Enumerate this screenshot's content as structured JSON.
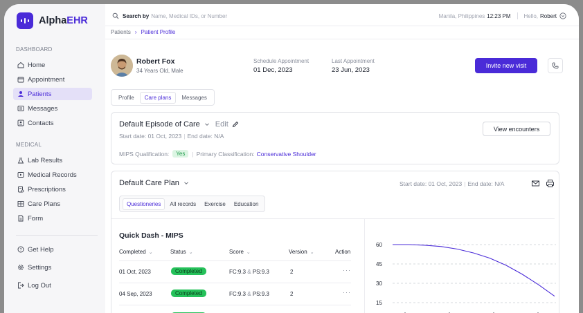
{
  "brand": {
    "name_prefix": "Alpha",
    "name_suffix": "EHR",
    "accent": "#4a2bd8"
  },
  "sidebar": {
    "dashboard_label": "DASHBOARD",
    "medical_label": "MEDICAL",
    "items": [
      {
        "label": "Home",
        "icon": "home-icon"
      },
      {
        "label": "Appointment",
        "icon": "calendar-icon"
      },
      {
        "label": "Patients",
        "icon": "user-icon",
        "active": true
      },
      {
        "label": "Messages",
        "icon": "message-icon"
      },
      {
        "label": "Contacts",
        "icon": "contacts-icon"
      }
    ],
    "medical_items": [
      {
        "label": "Lab Results",
        "icon": "flask-icon"
      },
      {
        "label": "Medical Records",
        "icon": "video-icon"
      },
      {
        "label": "Prescriptions",
        "icon": "prescription-icon"
      },
      {
        "label": "Care Plans",
        "icon": "grid-icon"
      },
      {
        "label": "Form",
        "icon": "document-icon"
      }
    ],
    "footer_items": [
      {
        "label": "Get Help",
        "icon": "help-icon"
      },
      {
        "label": "Settings",
        "icon": "gear-icon"
      },
      {
        "label": "Log Out",
        "icon": "logout-icon"
      }
    ]
  },
  "topbar": {
    "search_label": "Search by",
    "search_placeholder": "Name, Medical IDs, or Number",
    "location": "Manila, Philippines",
    "time": "12:23 PM",
    "greeting": "Hello,",
    "user": "Robert"
  },
  "breadcrumb": {
    "parent": "Patients",
    "current": "Patient Profile"
  },
  "patient": {
    "name": "Robert Fox",
    "meta": "34 Years Old, Male",
    "schedule_label": "Schedule Appointment",
    "schedule_value": "01 Dec, 2023",
    "last_label": "Last Appointment",
    "last_value": "23 Jun, 2023",
    "invite_label": "Invite new visit"
  },
  "tabs": [
    {
      "label": "Profile"
    },
    {
      "label": "Care plans",
      "active": true
    },
    {
      "label": "Messages"
    }
  ],
  "episode": {
    "title": "Default Episode of Care",
    "edit_label": "Edit",
    "start_date": "Start date: 01 Oct, 2023",
    "end_date": "End date: N/A",
    "view_encounters": "View encounters",
    "mips_label": "MIPS Qualification:",
    "mips_value": "Yes",
    "classification_label": "Primary Classification:",
    "classification_value": "Conservative Shoulder"
  },
  "care_plan": {
    "title": "Default Care Plan",
    "start_date": "Start date: 01 Oct, 2023",
    "end_date": "End date: N/A",
    "subtabs": [
      {
        "label": "Questioneries",
        "active": true
      },
      {
        "label": "All records"
      },
      {
        "label": "Exercise"
      },
      {
        "label": "Education"
      }
    ]
  },
  "quick_dash": {
    "title": "Quick Dash - MIPS",
    "headers": {
      "completed": "Completed",
      "status": "Status",
      "score": "Score",
      "version": "Version",
      "action": "Action"
    },
    "rows": [
      {
        "date": "01 Oct, 2023",
        "status": "Completed",
        "fc": "FC:9.3",
        "ps": "PS:9.3",
        "version": "2",
        "action": "···"
      },
      {
        "date": "04 Sep, 2023",
        "status": "Completed",
        "fc": "FC:9.3",
        "ps": "PS:9.3",
        "version": "2",
        "action": "···"
      }
    ],
    "amp": "&"
  },
  "chart_data": {
    "type": "line",
    "y_ticks": [
      "60",
      "45",
      "30",
      "15"
    ],
    "ylim": [
      0,
      60
    ],
    "series": [
      {
        "color": "#4a2bd8",
        "points": [
          [
            0,
            60
          ],
          [
            0.1,
            60
          ],
          [
            0.2,
            59.5
          ],
          [
            0.3,
            58.5
          ],
          [
            0.4,
            56.5
          ],
          [
            0.5,
            53.5
          ],
          [
            0.6,
            49.5
          ],
          [
            0.7,
            44
          ],
          [
            0.8,
            37
          ],
          [
            0.9,
            29
          ],
          [
            1.0,
            20
          ]
        ]
      }
    ]
  }
}
